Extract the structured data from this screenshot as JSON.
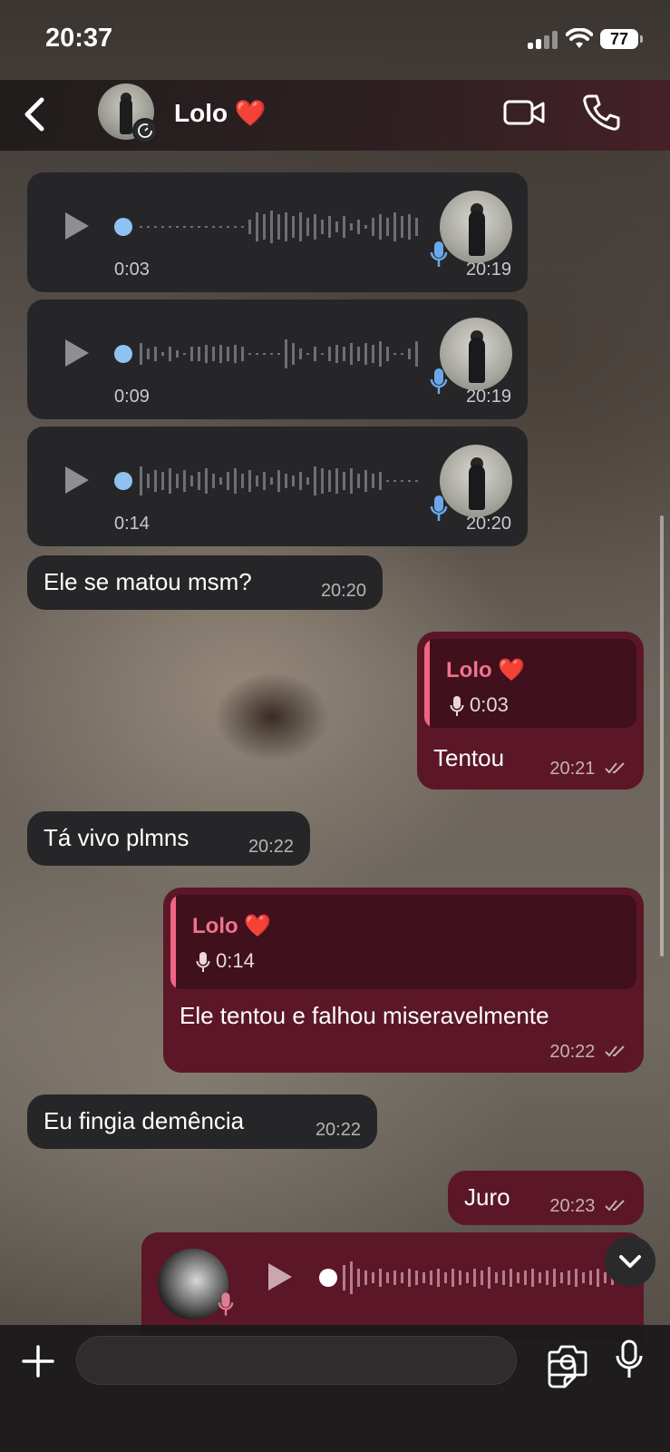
{
  "status": {
    "time": "20:37",
    "battery": "77"
  },
  "header": {
    "contact_name": "Lolo ❤️"
  },
  "voice_messages": [
    {
      "duration": "0:03",
      "time": "20:19"
    },
    {
      "duration": "0:09",
      "time": "20:19"
    },
    {
      "duration": "0:14",
      "time": "20:20"
    }
  ],
  "messages": [
    {
      "text": "Ele se matou msm?",
      "time": "20:20"
    },
    {
      "reply_name": "Lolo ❤️",
      "reply_duration": "0:03",
      "text": "Tentou",
      "time": "20:21"
    },
    {
      "text": "Tá vivo plmns",
      "time": "20:22"
    },
    {
      "reply_name": "Lolo ❤️",
      "reply_duration": "0:14",
      "text": "Ele tentou e falhou miseravelmente",
      "time": "20:22"
    },
    {
      "text": "Eu fingia demência",
      "time": "20:22"
    },
    {
      "text": "Juro",
      "time": "20:23"
    }
  ],
  "colors": {
    "incoming": "#262628",
    "outgoing": "#5b1727",
    "reply_accent": "#f06483",
    "play_dot": "#8fc2f0"
  },
  "icons": [
    "back-chevron-icon",
    "timer-icon",
    "video-call-icon",
    "phone-icon",
    "play-icon",
    "mic-icon",
    "double-check-icon",
    "chevron-down-icon",
    "plus-icon",
    "sticker-icon",
    "camera-icon"
  ]
}
